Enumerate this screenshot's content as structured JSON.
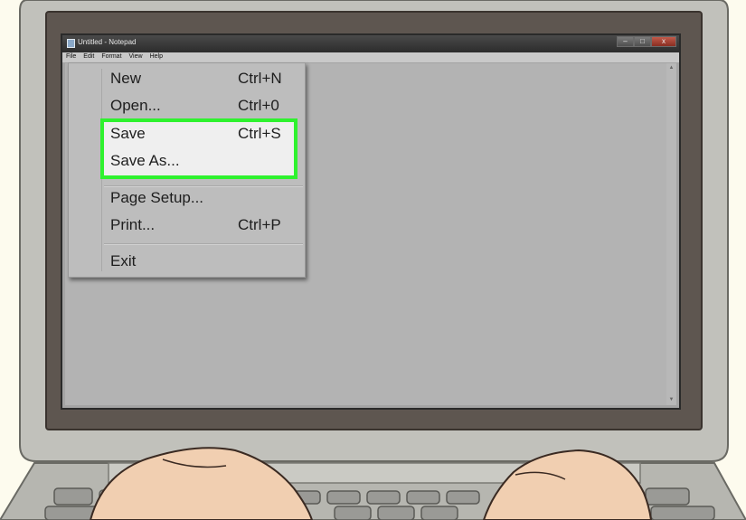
{
  "window": {
    "title": "Untitled - Notepad",
    "buttons": {
      "minimize": "–",
      "maximize": "□",
      "close": "x"
    }
  },
  "menubar": [
    "File",
    "Edit",
    "Format",
    "View",
    "Help"
  ],
  "file_menu": {
    "new": {
      "label": "New",
      "shortcut": "Ctrl+N"
    },
    "open": {
      "label": "Open...",
      "shortcut": "Ctrl+0"
    },
    "save": {
      "label": "Save",
      "shortcut": "Ctrl+S"
    },
    "save_as": {
      "label": "Save As..."
    },
    "page_setup": {
      "label": "Page Setup..."
    },
    "print": {
      "label": "Print...",
      "shortcut": "Ctrl+P"
    },
    "exit": {
      "label": "Exit"
    }
  },
  "scrollbar": {
    "up": "▲",
    "down": "▼"
  },
  "colors": {
    "highlight_border": "#2ef22e",
    "page_background": "#fdfbee",
    "skin": "#f1cfb1"
  }
}
